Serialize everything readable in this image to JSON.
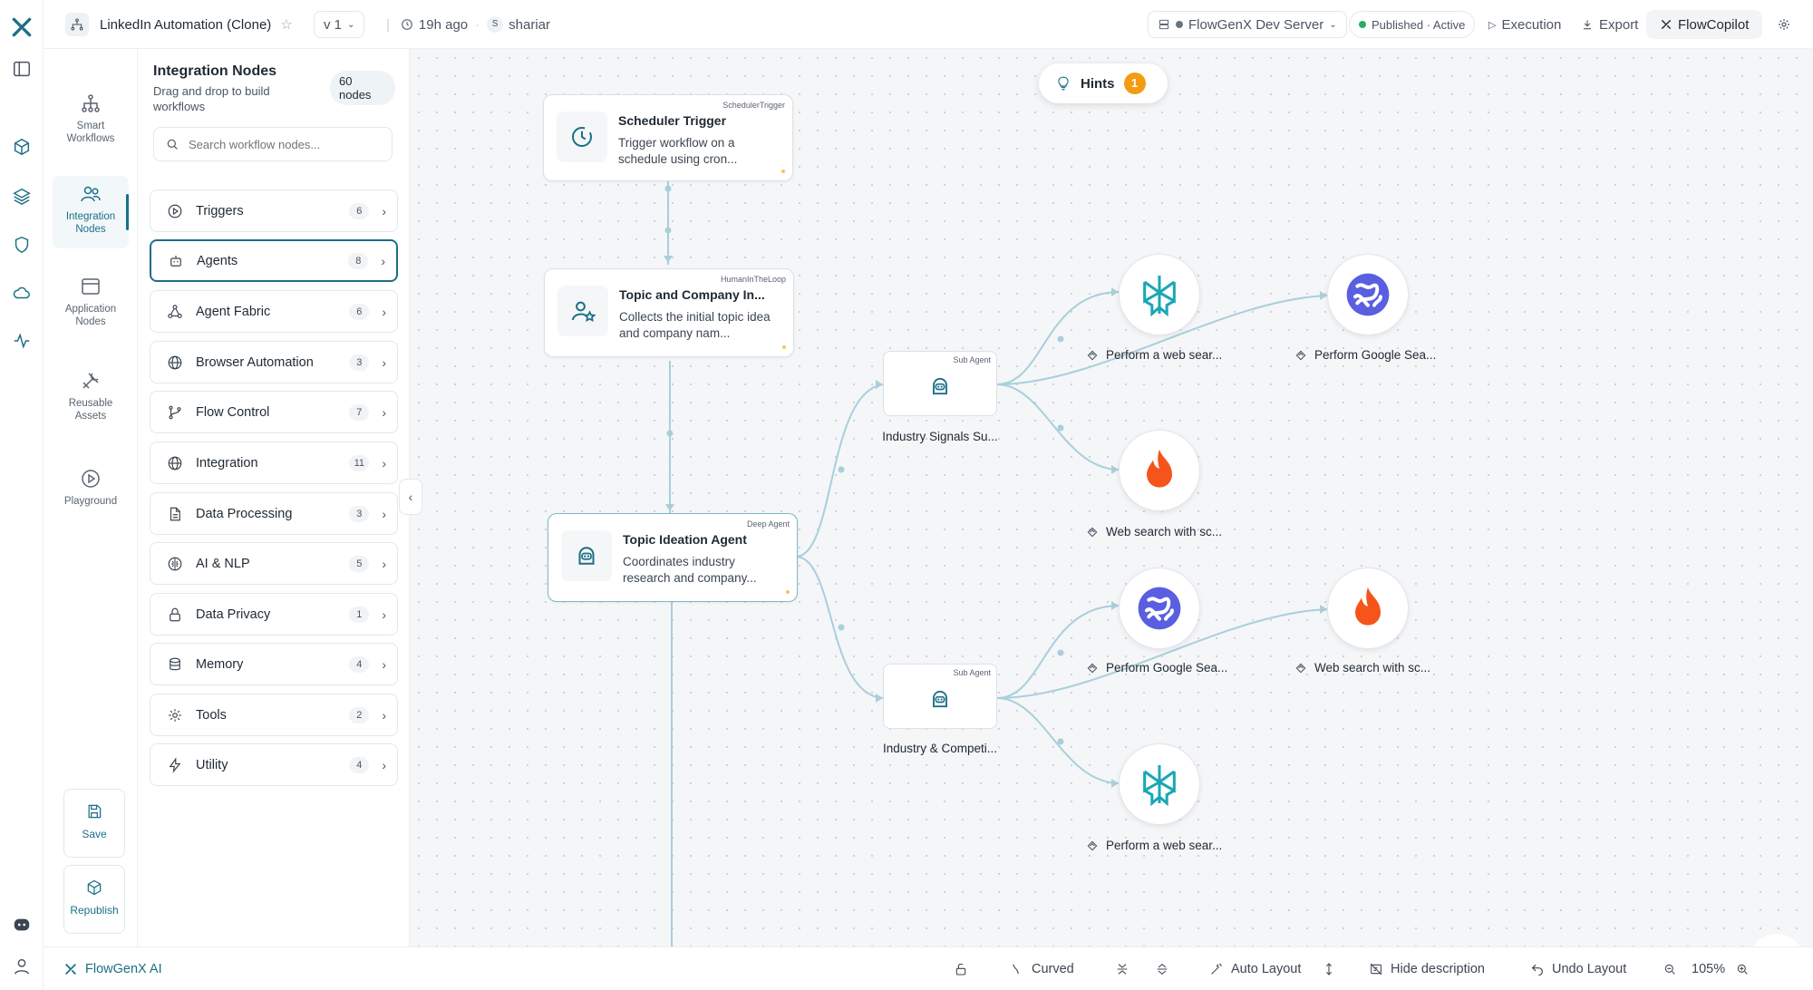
{
  "colors": {
    "accent": "#1b6f86",
    "edge": "#a9cfdb",
    "published": "#27ae60",
    "hint_badge": "#f39c12",
    "fire": "#f5541a",
    "purple": "#5a5ee0"
  },
  "topbar": {
    "workflow_name": "LinkedIn Automation (Clone)",
    "version": "v 1",
    "updated": "19h ago",
    "user_initial": "S",
    "user": "shariar",
    "server": "FlowGenX Dev Server",
    "status": "Published · Active",
    "execution": "Execution",
    "export": "Export",
    "copilot": "FlowCopilot"
  },
  "categories": [
    {
      "label": "Smart Workflows",
      "icon": "hierarchy-icon"
    },
    {
      "label": "Integration Nodes",
      "icon": "users-icon",
      "active": true
    },
    {
      "label": "Application Nodes",
      "icon": "window-icon"
    },
    {
      "label": "Reusable Assets",
      "icon": "tools-icon"
    },
    {
      "label": "Playground",
      "icon": "play-icon"
    }
  ],
  "actions": {
    "save": "Save",
    "republish": "Republish"
  },
  "panel": {
    "title": "Integration Nodes",
    "subtitle": "Drag and drop to build workflows",
    "badge": "60 nodes",
    "search_placeholder": "Search workflow nodes...",
    "items": [
      {
        "label": "Triggers",
        "count": "6",
        "icon": "play-circle-icon"
      },
      {
        "label": "Agents",
        "count": "8",
        "icon": "robot-icon",
        "active": true
      },
      {
        "label": "Agent Fabric",
        "count": "6",
        "icon": "network-icon"
      },
      {
        "label": "Browser Automation",
        "count": "3",
        "icon": "globe-icon"
      },
      {
        "label": "Flow Control",
        "count": "7",
        "icon": "branch-icon"
      },
      {
        "label": "Integration",
        "count": "11",
        "icon": "globe-icon"
      },
      {
        "label": "Data Processing",
        "count": "3",
        "icon": "document-icon"
      },
      {
        "label": "AI & NLP",
        "count": "5",
        "icon": "brain-icon"
      },
      {
        "label": "Data Privacy",
        "count": "1",
        "icon": "lock-icon"
      },
      {
        "label": "Memory",
        "count": "4",
        "icon": "database-icon"
      },
      {
        "label": "Tools",
        "count": "2",
        "icon": "gear-icon"
      },
      {
        "label": "Utility",
        "count": "4",
        "icon": "bolt-icon"
      }
    ]
  },
  "canvas": {
    "hints_label": "Hints",
    "hints_count": "1",
    "nodes": {
      "scheduler": {
        "tag": "SchedulerTrigger",
        "title": "Scheduler Trigger",
        "desc": "Trigger workflow on a schedule using cron..."
      },
      "topic_input": {
        "tag": "HumanInTheLoop",
        "title": "Topic and Company In...",
        "desc": "Collects the initial topic idea and company nam..."
      },
      "ideation": {
        "tag": "Deep Agent",
        "title": "Topic Ideation Agent",
        "desc": "Coordinates industry research and company..."
      },
      "sub1": {
        "tag": "Sub Agent",
        "label": "Industry Signals Su..."
      },
      "sub2": {
        "tag": "Sub Agent",
        "label": "Industry & Competi..."
      }
    },
    "tools": [
      "Perform a web sear...",
      "Perform Google Sea...",
      "Web search with sc...",
      "Perform Google Sea...",
      "Web search with sc...",
      "Perform a web sear..."
    ]
  },
  "bottombar": {
    "brand": "FlowGenX AI",
    "curved": "Curved",
    "auto_layout": "Auto Layout",
    "hide_description": "Hide description",
    "undo_layout": "Undo Layout",
    "zoom": "105%"
  }
}
